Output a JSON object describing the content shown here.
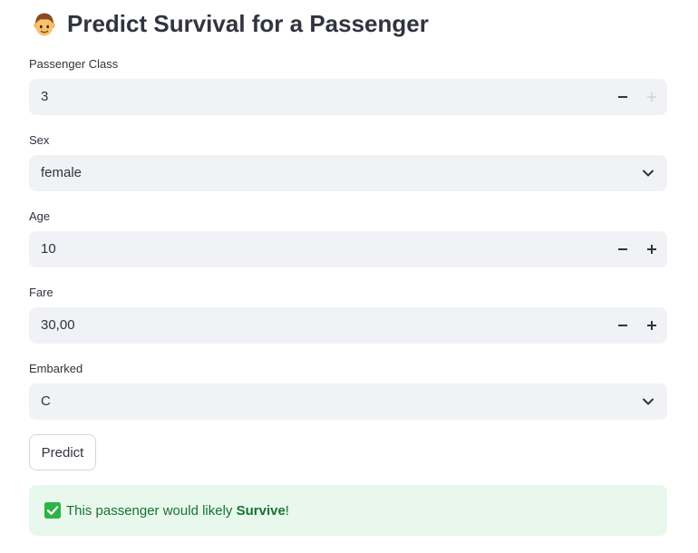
{
  "title": {
    "emoji": "person-emoji",
    "text": "Predict Survival for a Passenger"
  },
  "fields": {
    "passenger_class": {
      "label": "Passenger Class",
      "value": "3",
      "minus_icon": "minus-icon",
      "plus_icon": "plus-icon",
      "plus_disabled": true
    },
    "sex": {
      "label": "Sex",
      "value": "female",
      "icon": "chevron-down-icon"
    },
    "age": {
      "label": "Age",
      "value": "10",
      "minus_icon": "minus-icon",
      "plus_icon": "plus-icon"
    },
    "fare": {
      "label": "Fare",
      "value": "30,00",
      "minus_icon": "minus-icon",
      "plus_icon": "plus-icon"
    },
    "embarked": {
      "label": "Embarked",
      "value": "C",
      "icon": "chevron-down-icon"
    }
  },
  "predict_button": {
    "label": "Predict"
  },
  "result": {
    "icon": "check-mark-icon",
    "prefix": "This passenger would likely ",
    "outcome": "Survive",
    "suffix": "!"
  },
  "colors": {
    "input_background": "#f0f2f6",
    "text": "#31333f",
    "success_background": "#e8f8ec",
    "success_text": "#177233",
    "check_green": "#2fb344"
  }
}
